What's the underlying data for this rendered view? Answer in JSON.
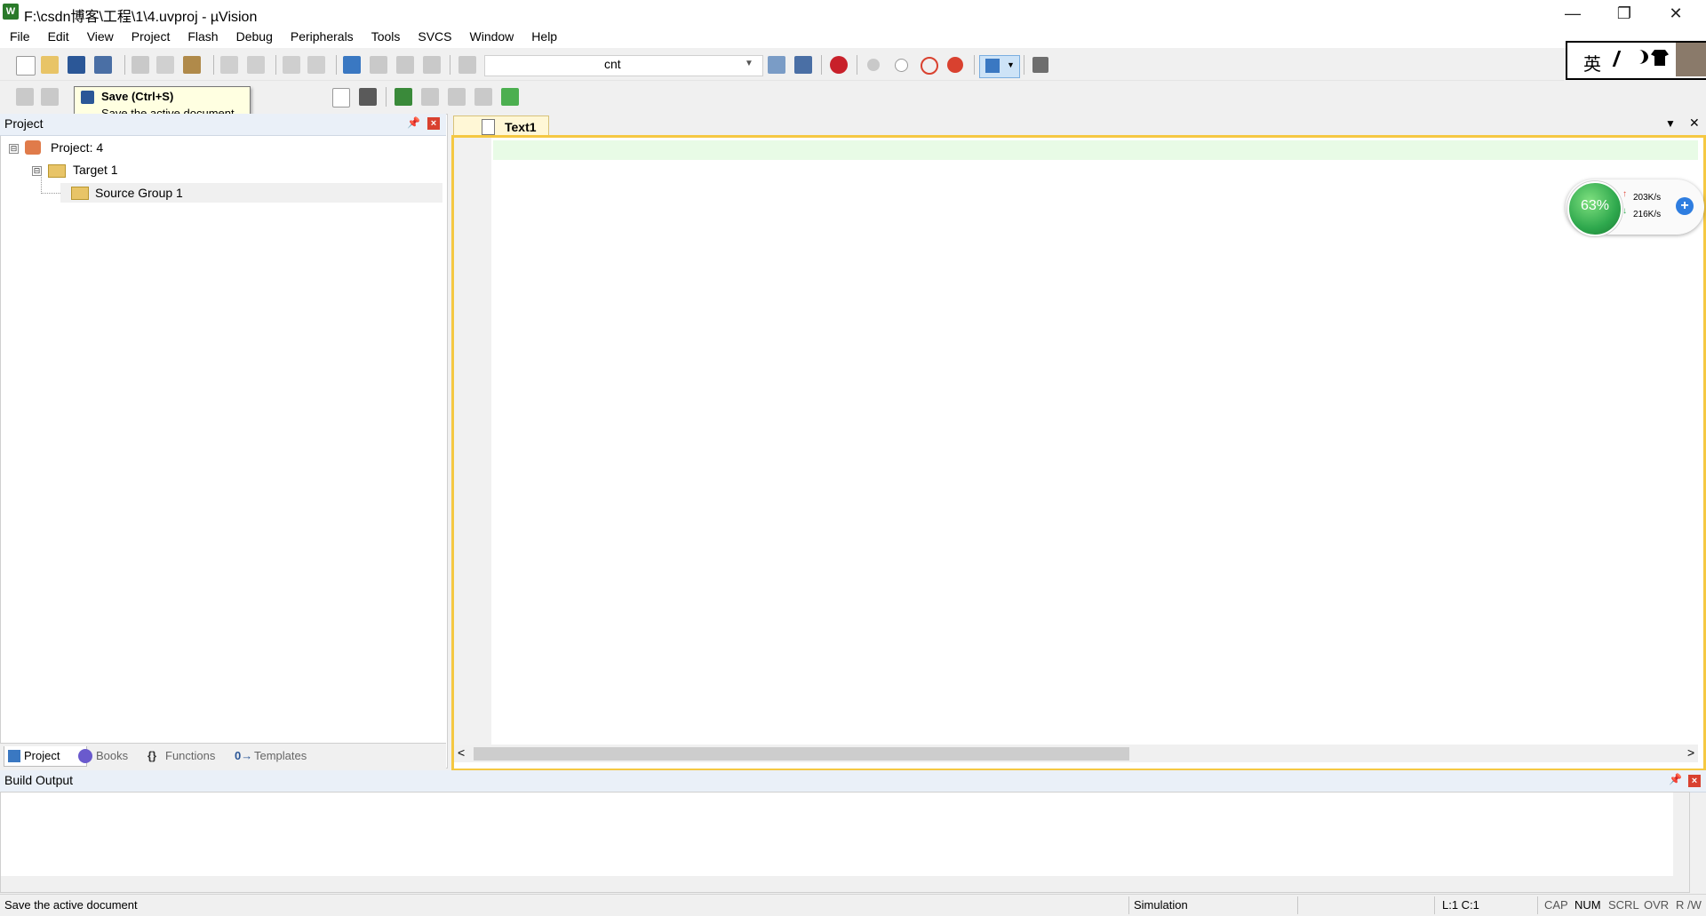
{
  "window": {
    "title": "F:\\csdn博客\\工程\\1\\4.uvproj - µVision",
    "app_icon": "W",
    "controls": {
      "minimize": "—",
      "restore": "❐",
      "close": "✕"
    }
  },
  "menu": [
    "File",
    "Edit",
    "View",
    "Project",
    "Flash",
    "Debug",
    "Peripherals",
    "Tools",
    "SVCS",
    "Window",
    "Help"
  ],
  "toolbar": {
    "find_text": "cnt",
    "icons": [
      "new-file-icon",
      "open-file-icon",
      "save-icon",
      "save-all-icon",
      "cut-icon",
      "copy-icon",
      "paste-icon",
      "undo-icon",
      "redo-icon",
      "nav-back-icon",
      "nav-forward-icon",
      "bookmark-icon",
      "prev-bookmark-icon",
      "next-bookmark-icon",
      "clear-bookmarks-icon",
      "indent-icon",
      "unindent-icon",
      "comment-icon",
      "uncomment-icon",
      "find-in-files-icon",
      "find-icon",
      "incremental-find-icon",
      "debug-session-icon",
      "breakpoint-icon",
      "disable-breakpoint-icon",
      "kill-breakpoints-icon",
      "kill-all-breakpoints-icon",
      "window-layout-icon",
      "configure-icon"
    ]
  },
  "tooltip": {
    "title": "Save (Ctrl+S)",
    "description": "Save the active document"
  },
  "project_panel": {
    "title": "Project",
    "pin": "📌",
    "close": "×",
    "tree": [
      {
        "label": "Project: 4",
        "expander": "⊟"
      },
      {
        "label": "Target 1",
        "expander": "⊟"
      },
      {
        "label": "Source Group 1"
      }
    ],
    "tabs": [
      {
        "label": "Project",
        "icon": "project-tab-icon"
      },
      {
        "label": "Books",
        "icon": "books-tab-icon"
      },
      {
        "label": "Functions",
        "glyph": "{}"
      },
      {
        "label": "Templates",
        "glyph": "0→"
      }
    ]
  },
  "editor": {
    "tab_label": "Text1",
    "dropdown": "▼",
    "close": "✕",
    "scroll_left": "<",
    "scroll_right": ">"
  },
  "build_output": {
    "title": "Build Output",
    "pin": "📌",
    "close": "×"
  },
  "status_bar": {
    "message": "Save the active document",
    "mode": "Simulation",
    "position": "L:1 C:1",
    "caps": "CAP",
    "num": "NUM",
    "scrl": "SCRL",
    "ovr": "OVR",
    "rw": "R /W"
  },
  "ime_widget": {
    "lang": "英"
  },
  "net_widget": {
    "percent": "63%",
    "up_speed": "203K/s",
    "down_speed": "216K/s",
    "plus": "+"
  },
  "colors": {
    "editor_border": "#f5c842",
    "tab_fill": "#fff7d6",
    "current_line": "#e8fbe6",
    "panel_header": "#eaf0f8",
    "net_green": "#2ea84d"
  }
}
